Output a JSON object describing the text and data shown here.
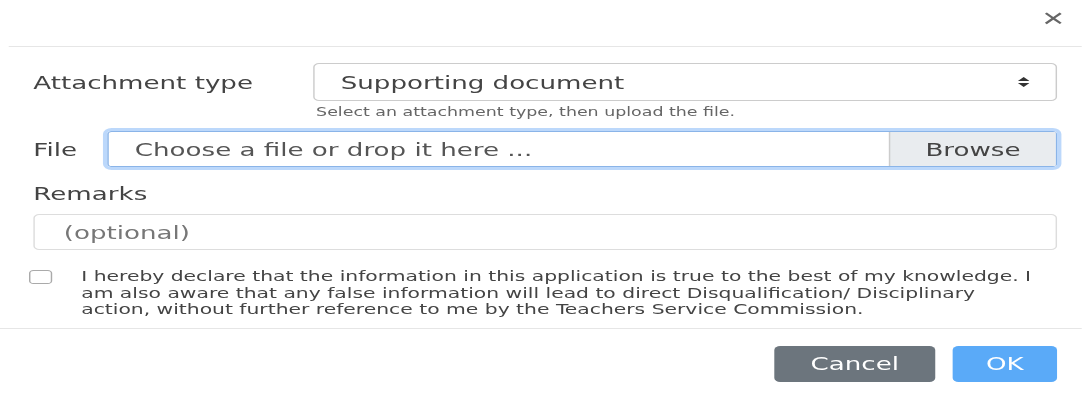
{
  "dialog": {
    "close": "×"
  },
  "attachment_type": {
    "label": "Attachment type",
    "value": "Supporting document",
    "help": "Select an attachment type, then upload the file."
  },
  "file": {
    "label": "File",
    "placeholder": "Choose a file or drop it here ...",
    "button": "Browse",
    "focused": true
  },
  "remarks": {
    "label": "Remarks",
    "placeholder": "(optional)"
  },
  "declaration": {
    "checked": false,
    "text": "I hereby declare that the information in this application is true to the best of my knowledge. I am also aware that any false information will lead to direct Disqualification/ Disciplinary action, without further reference to me by the Teachers Service Commission."
  },
  "buttons": [
    {
      "label": "Cancel",
      "kind": "secondary"
    },
    {
      "label": "OK",
      "kind": "primary"
    }
  ]
}
